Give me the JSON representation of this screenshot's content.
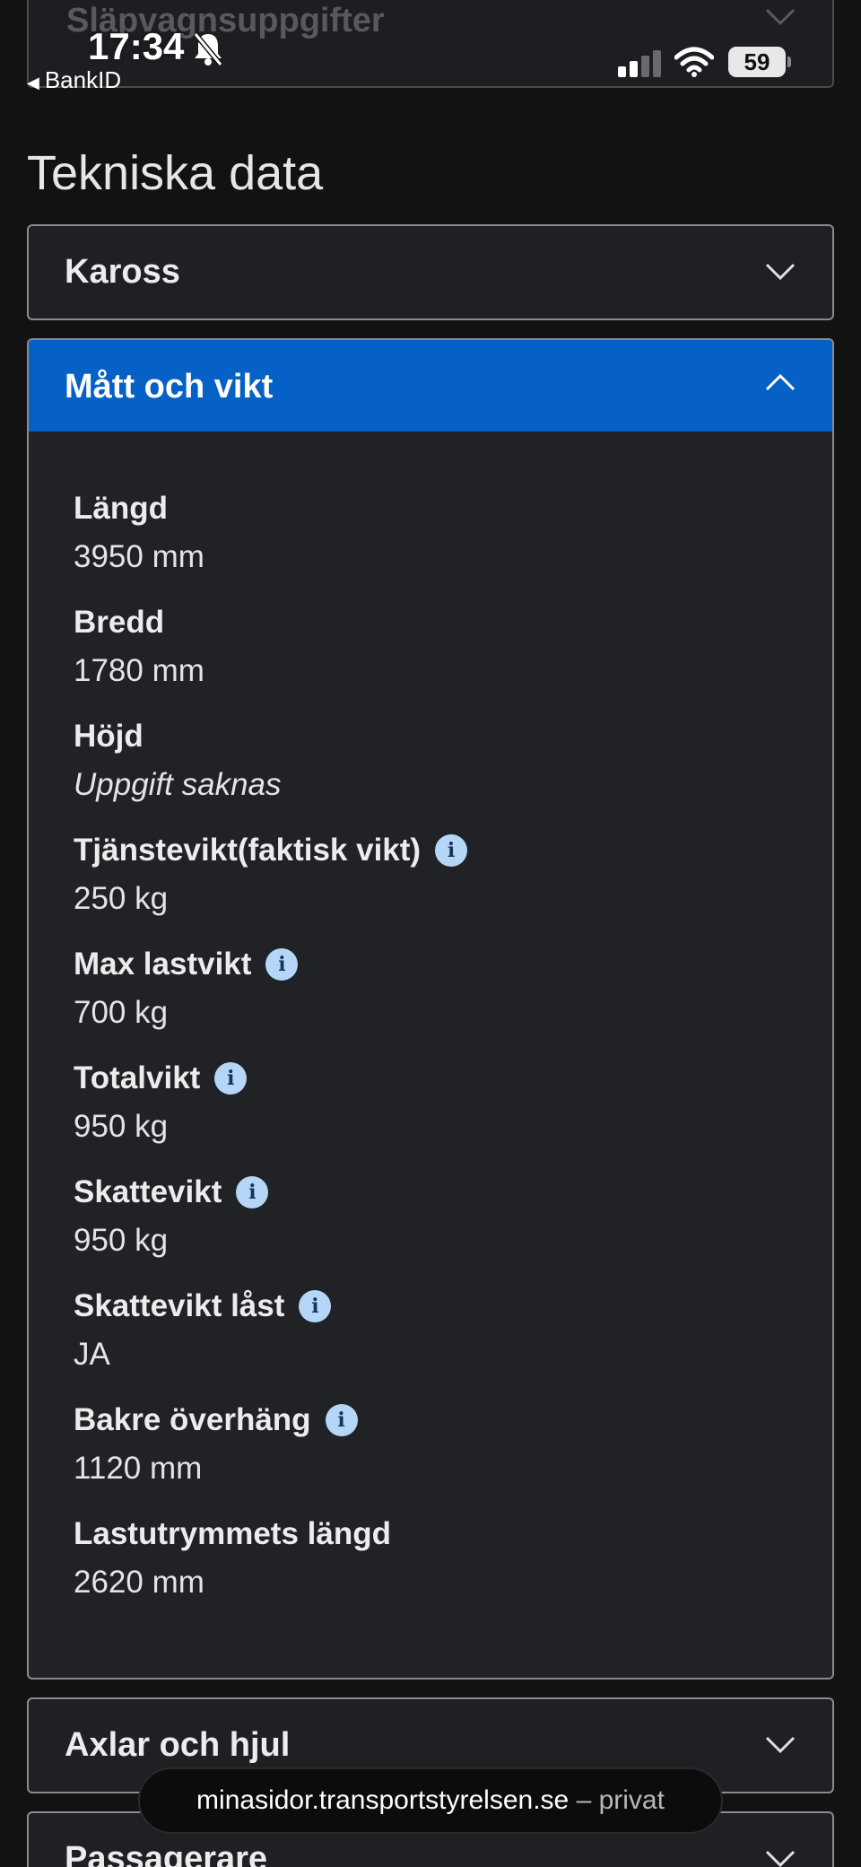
{
  "status_bar": {
    "time": "17:34",
    "back_app": "BankID",
    "battery": "59"
  },
  "previous_section": {
    "label": "Släpvagnsuppgifter"
  },
  "section_title": "Tekniska data",
  "accordions": {
    "kaross": {
      "label": "Kaross"
    },
    "matt_och_vikt": {
      "label": "Mått och vikt",
      "fields": [
        {
          "label": "Längd",
          "value": "3950 mm"
        },
        {
          "label": "Bredd",
          "value": "1780 mm"
        },
        {
          "label": "Höjd",
          "value": "Uppgift saknas"
        },
        {
          "label": "Tjänstevikt(faktisk vikt)",
          "value": "250 kg"
        },
        {
          "label": "Max lastvikt",
          "value": "700 kg"
        },
        {
          "label": "Totalvikt",
          "value": "950 kg"
        },
        {
          "label": "Skattevikt",
          "value": "950 kg"
        },
        {
          "label": "Skattevikt låst",
          "value": "JA"
        },
        {
          "label": "Bakre överhäng",
          "value": "1120 mm"
        },
        {
          "label": "Lastutrymmets längd",
          "value": "2620 mm"
        }
      ]
    },
    "axlar_och_hjul": {
      "label": "Axlar och hjul"
    },
    "passagerare": {
      "label": "Passagerare"
    }
  },
  "url_bar": {
    "domain": "minasidor.transportstyrelsen.se",
    "separator": " – ",
    "mode": "privat"
  },
  "colors": {
    "accent": "#0561c5",
    "background": "#121213",
    "panel": "#212226",
    "info_icon": "#b6d6f7"
  }
}
